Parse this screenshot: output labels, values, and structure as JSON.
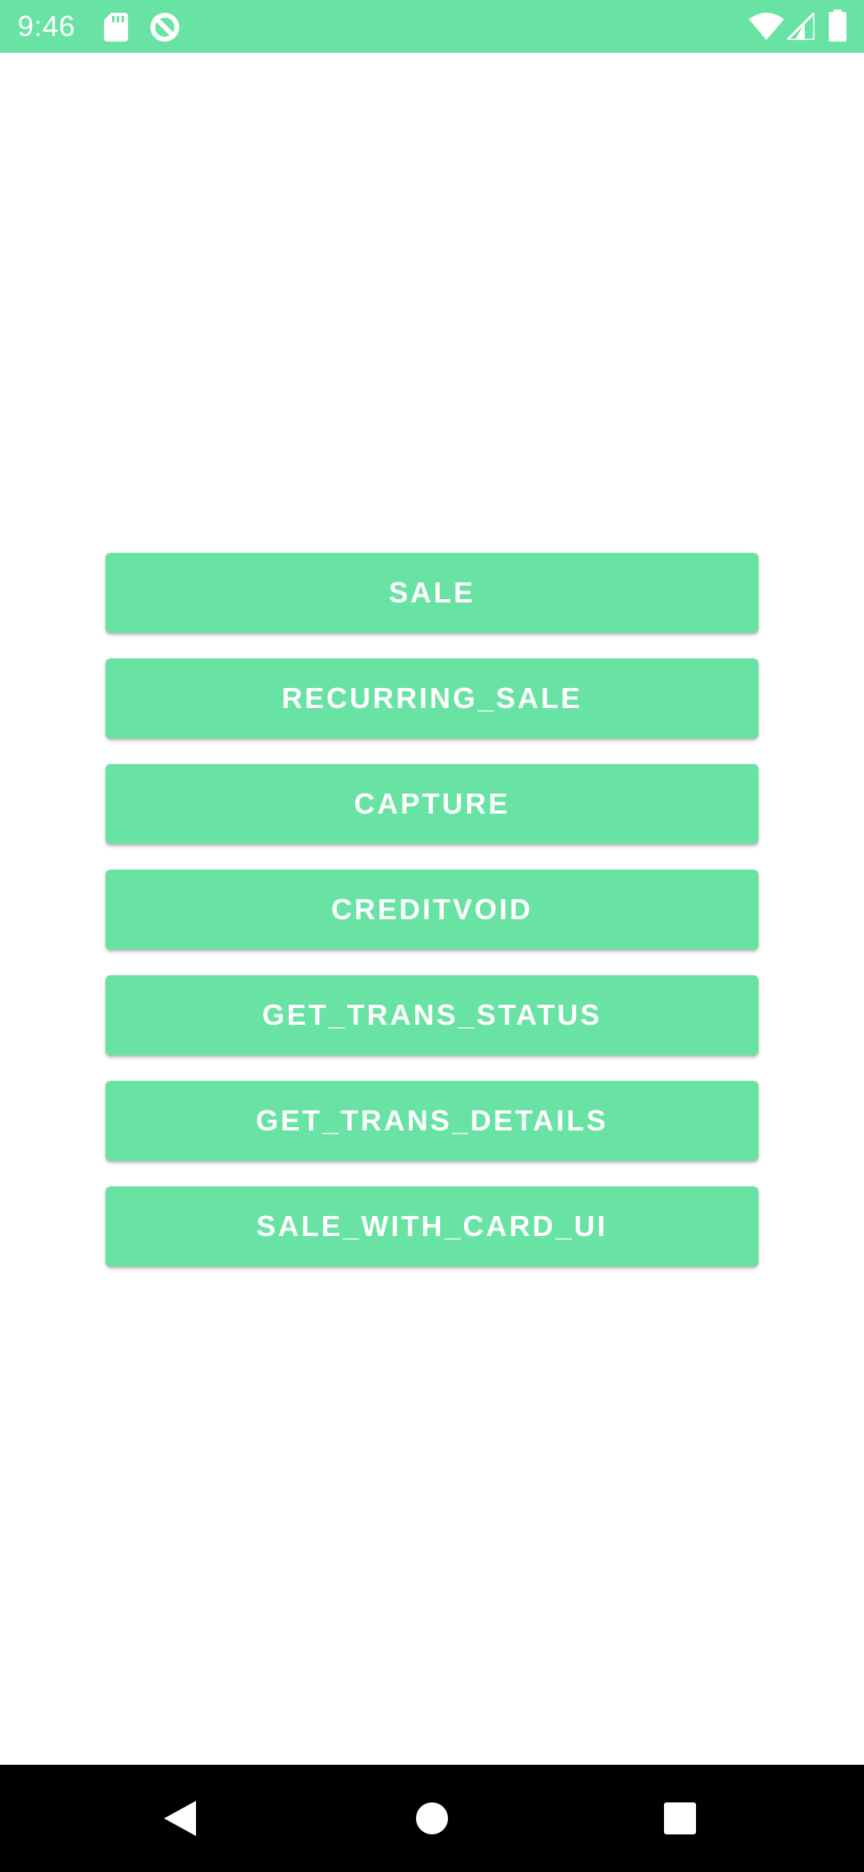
{
  "status_bar": {
    "time": "9:46",
    "background_color": "#69e3a4",
    "left_icons": [
      "sd-card-icon",
      "data-saver-icon"
    ],
    "right_icons": [
      "wifi-icon",
      "cell-signal-icon",
      "battery-icon"
    ]
  },
  "buttons": [
    {
      "label": "SALE"
    },
    {
      "label": "RECURRING_SALE"
    },
    {
      "label": "CAPTURE"
    },
    {
      "label": "CREDITVOID"
    },
    {
      "label": "GET_TRANS_STATUS"
    },
    {
      "label": "GET_TRANS_DETAILS"
    },
    {
      "label": "SALE_WITH_CARD_UI"
    }
  ],
  "theme": {
    "accent": "#69e3a4",
    "button_text": "#ffffff",
    "background": "#ffffff"
  },
  "nav_bar": {
    "icons": [
      "back-icon",
      "home-icon",
      "recents-icon"
    ]
  }
}
